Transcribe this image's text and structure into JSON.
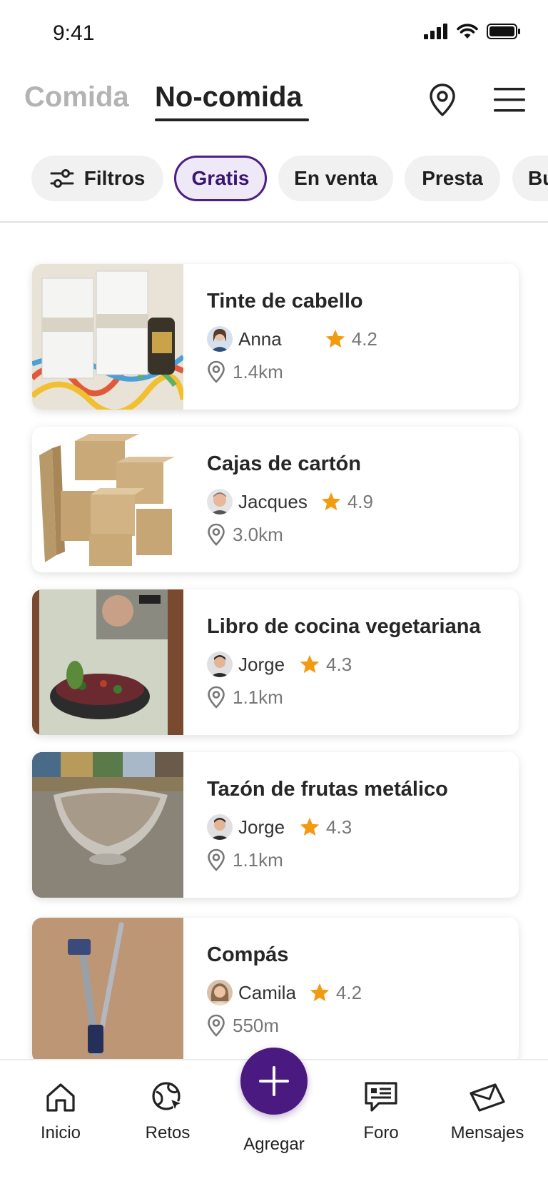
{
  "status_bar": {
    "time": "9:41"
  },
  "header": {
    "tabs": [
      {
        "label": "Comida",
        "active": false
      },
      {
        "label": "No-comida",
        "active": true
      }
    ]
  },
  "filters": {
    "filter_button": "Filtros",
    "chips": [
      "Gratis",
      "En venta",
      "Presta",
      "Bu"
    ],
    "selected": "Gratis",
    "accent_color": "#4b1f86"
  },
  "listings": [
    {
      "title": "Tinte de cabello",
      "user": "Anna",
      "rating": "4.2",
      "distance": "1.4km"
    },
    {
      "title": "Cajas de cartón",
      "user": "Jacques",
      "rating": "4.9",
      "distance": "3.0km"
    },
    {
      "title": "Libro de cocina vegetariana",
      "user": "Jorge",
      "rating": "4.3",
      "distance": "1.1km"
    },
    {
      "title": "Tazón de frutas metálico",
      "user": "Jorge",
      "rating": "4.3",
      "distance": "1.1km"
    },
    {
      "title": "Compás",
      "user": "Camila",
      "rating": "4.2",
      "distance": "550m"
    }
  ],
  "nav": {
    "items": [
      {
        "label": "Inicio",
        "icon": "home-icon"
      },
      {
        "label": "Retos",
        "icon": "globe-cursor-icon"
      },
      {
        "label": "Agregar",
        "icon": "plus-icon"
      },
      {
        "label": "Foro",
        "icon": "chat-icon"
      },
      {
        "label": "Mensajes",
        "icon": "envelope-icon"
      }
    ],
    "fab_color": "#4b1a80"
  }
}
